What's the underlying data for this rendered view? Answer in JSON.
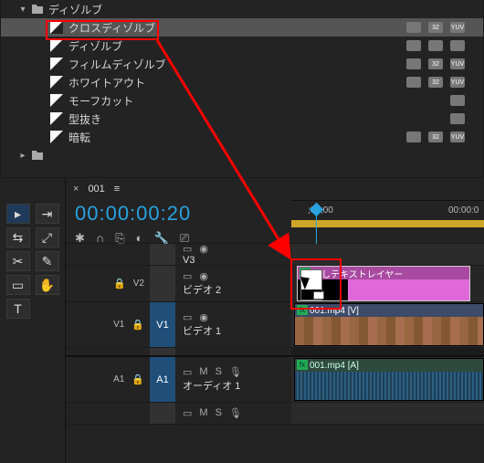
{
  "effects": {
    "folder": "ディゾルブ",
    "bottom_folder": "",
    "items": [
      {
        "name": "クロスディゾルブ",
        "badges": [
          "",
          "32",
          "YUV"
        ],
        "selected": true
      },
      {
        "name": "ディゾルブ",
        "badges": [
          "",
          "",
          ""
        ]
      },
      {
        "name": "フィルムディゾルブ",
        "badges": [
          "",
          "32",
          "YUV"
        ]
      },
      {
        "name": "ホワイトアウト",
        "badges": [
          "",
          "32",
          "YUV"
        ]
      },
      {
        "name": "モーフカット",
        "badges": [
          ""
        ]
      },
      {
        "name": "型抜き",
        "badges": [
          ""
        ]
      },
      {
        "name": "暗転",
        "badges": [
          "",
          "32",
          "YUV"
        ]
      }
    ]
  },
  "timeline": {
    "tab": "001",
    "timecode": "00:00:00:20",
    "ruler": {
      "t0": ";00;00",
      "t1": "00:00:0"
    },
    "tracks": {
      "v3_label": "V3",
      "v2": {
        "tag": "V2",
        "name": "ビデオ 2"
      },
      "v1": {
        "tag": "V1",
        "toggle": "V1",
        "name": "ビデオ 1"
      },
      "a1": {
        "tag": "A1",
        "toggle": "A1",
        "name": "オーディオ 1"
      }
    },
    "clips": {
      "v3_title": "新しテキストレイヤー",
      "v1_title": "001.mp4 [V]",
      "a1_title": "001.mp4 [A]"
    }
  }
}
